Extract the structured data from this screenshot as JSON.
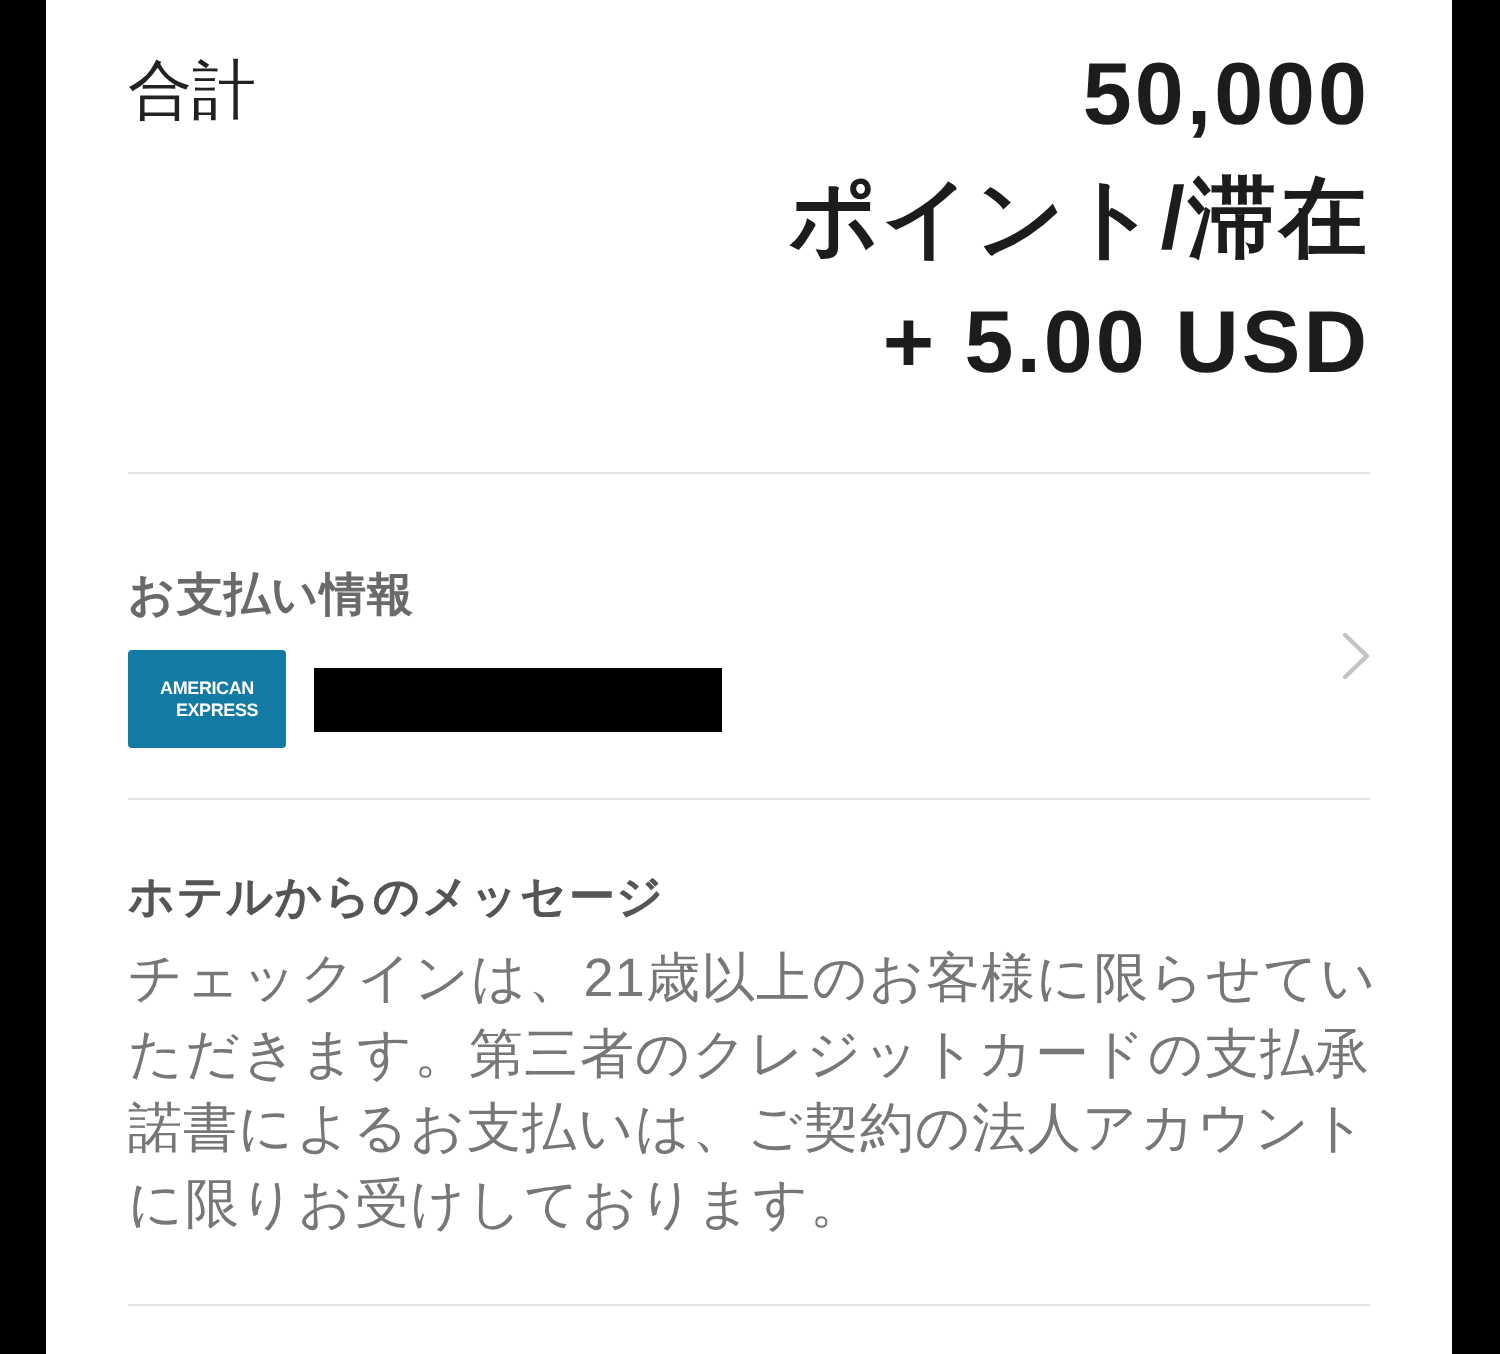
{
  "total": {
    "label": "合計",
    "amount_lines": [
      "50,000",
      "ポイント/滞在",
      "+ 5.00 USD"
    ]
  },
  "payment": {
    "heading": "お支払い情報",
    "card_logo_lines": [
      "AMERICAN",
      "EXPRESS"
    ]
  },
  "hotel_message": {
    "heading": "ホテルからのメッセージ",
    "body": "チェックインは、21歳以上のお客様に限らせていただきます。第三者のクレジットカードの支払承諾書によるお支払いは、ご契約の法人アカウントに限りお受けしております。"
  }
}
